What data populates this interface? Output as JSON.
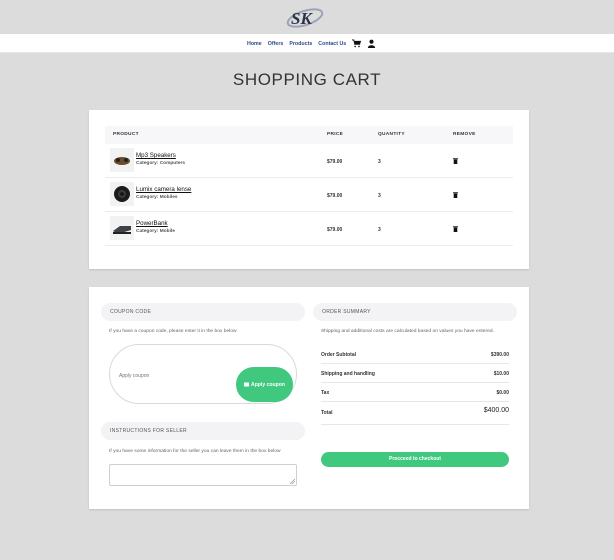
{
  "header": {
    "logo_text": "SK",
    "nav": [
      "Home",
      "Offers",
      "Products",
      "Contact Us"
    ]
  },
  "page_title": "SHOPPING CART",
  "cart": {
    "columns": [
      "PRODUCT",
      "PRICE",
      "QUANTITY",
      "REMOVE"
    ],
    "items": [
      {
        "name": "Mp3 Speakers",
        "category": "Category: Computers",
        "price": "$79.00",
        "qty": "3"
      },
      {
        "name": "Lumix camera lense",
        "category": "Category: Mobiles",
        "price": "$79.00",
        "qty": "3"
      },
      {
        "name": "PowerBank",
        "category": "Category: Mobile",
        "price": "$79.00",
        "qty": "3"
      }
    ]
  },
  "coupon": {
    "heading": "COUPON CODE",
    "hint": "If you have a coupon code, please enter it in the box below",
    "placeholder": "Apply coupon",
    "button": "Apply coupon"
  },
  "seller": {
    "heading": "INSTRUCTIONS FOR SELLER",
    "hint": "If you have some information for the seller you can leave them in the box below"
  },
  "summary": {
    "heading": "ORDER SUMMARY",
    "note": "Shipping and additional costs are calculated based on values you have entered.",
    "rows": [
      {
        "label": "Order Subtotal",
        "value": "$390.00"
      },
      {
        "label": "Shipping and handling",
        "value": "$10.00"
      },
      {
        "label": "Tax",
        "value": "$0.00"
      }
    ],
    "total_label": "Total",
    "total_value": "$400.00",
    "checkout": "Procceed to checkout"
  },
  "colors": {
    "accent": "#3fc87e",
    "nav_link": "#2c4a8a",
    "background": "#dcdcdc"
  }
}
